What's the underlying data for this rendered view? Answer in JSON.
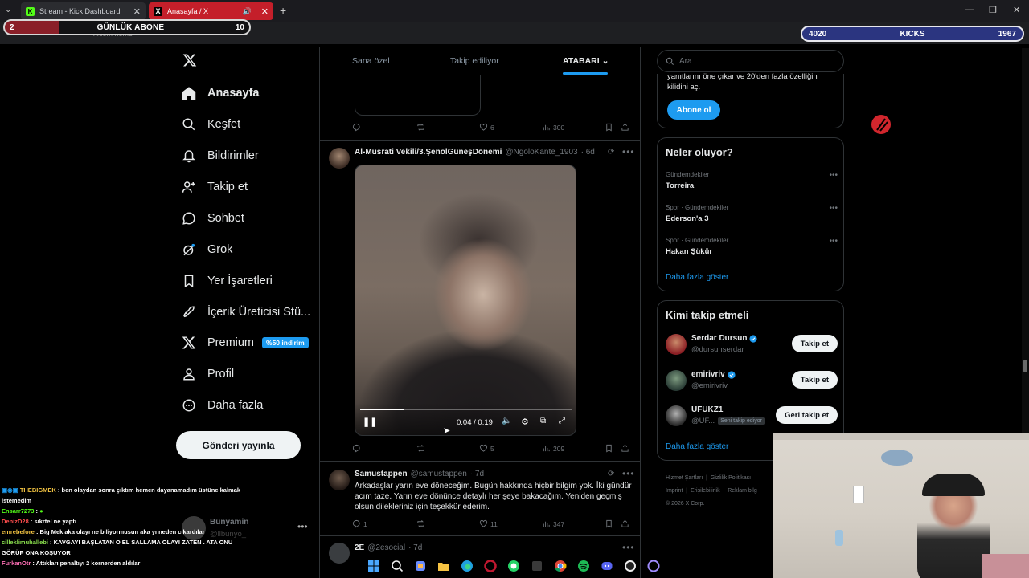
{
  "browser": {
    "tabs": [
      {
        "title": "Stream - Kick Dashboard"
      },
      {
        "title": "Anasayfa / X"
      }
    ],
    "address": "x.com/home"
  },
  "overlay": {
    "gunluk_left": "2",
    "gunluk_label": "GÜNLÜK ABONE",
    "gunluk_right": "10",
    "kicks_left": "4020",
    "kicks_label": "KICKS",
    "kicks_right": "1967"
  },
  "nav": {
    "items": [
      {
        "label": "Anasayfa",
        "icon": "home-icon"
      },
      {
        "label": "Keşfet",
        "icon": "search-icon"
      },
      {
        "label": "Bildirimler",
        "icon": "bell-icon"
      },
      {
        "label": "Takip et",
        "icon": "add-user-icon"
      },
      {
        "label": "Sohbet",
        "icon": "chat-bubble-icon"
      },
      {
        "label": "Grok",
        "icon": "grok-icon"
      },
      {
        "label": "Yer İşaretleri",
        "icon": "bookmark-icon"
      },
      {
        "label": "İçerik Üreticisi Stü...",
        "icon": "rocket-icon"
      },
      {
        "label": "Premium",
        "icon": "x-logo-icon"
      },
      {
        "label": "Profil",
        "icon": "person-icon"
      },
      {
        "label": "Daha fazla",
        "icon": "more-circle-icon"
      }
    ],
    "premium_badge": "%50 indirim",
    "post_button": "Gönderi yayınla",
    "user_name": "Bünyamin",
    "user_handle": "@llbunyo_"
  },
  "timeline": {
    "tabs": [
      "Sana özel",
      "Takip ediliyor",
      "ATABARI"
    ],
    "post0": {
      "likes": "6",
      "views": "300"
    },
    "post1": {
      "name": "Al-Musrati Vekili/3.ŞenolGüneşDönemi",
      "handle": "@NgoloKante_1903",
      "time": "· 6d",
      "video_time": "0:04 / 0:19",
      "video_progress": 0.21,
      "likes": "5",
      "views": "209"
    },
    "post2": {
      "name": "Samustappen",
      "handle": "@samustappen",
      "time": "· 7d",
      "text": "Arkadaşlar yarın eve döneceğim. Bugün hakkında hiçbir bilgim yok. İki gündür acım taze. Yarın eve dönünce detaylı her şeye bakacağım. Yeniden geçmiş olsun dilekleriniz için teşekkür ederim.",
      "replies": "1",
      "likes": "11",
      "views": "347"
    },
    "post3": {
      "name": "2E",
      "handle": "@2esocial",
      "time": "· 7d"
    }
  },
  "sidebar": {
    "search_placeholder": "Ara",
    "premium_text_1": "yanıtlarını öne çıkar ve 20'den fazla özelliğin",
    "premium_text_2": "kilidini aç.",
    "subscribe": "Abone ol",
    "trends_title": "Neler oluyor?",
    "trends": [
      {
        "category": "Gündemdekiler",
        "title": "Torreira"
      },
      {
        "category": "Spor · Gündemdekiler",
        "title": "Ederson'a 3"
      },
      {
        "category": "Spor · Gündemdekiler",
        "title": "Hakan Şükür"
      }
    ],
    "show_more": "Daha fazla göster",
    "wtf_title": "Kimi takip etmeli",
    "who_to_follow": [
      {
        "name": "Serdar Dursun",
        "handle": "@dursunserdar",
        "button": "Takip et"
      },
      {
        "name": "emirivriv",
        "handle": "@emirivriv",
        "button": "Takip et"
      },
      {
        "name": "UFUKZ1",
        "handle": "@UF...",
        "tag": "Seni takip ediyor",
        "button": "Geri takip et"
      }
    ],
    "wtf_show_more": "Daha fazla göster",
    "legal": {
      "l1a": "Hizmet Şartları",
      "l1b": "Gizlilik Politikası",
      "l2a": "Imprint",
      "l2b": "Erişilebilirlik",
      "l2c": "Reklam bilg",
      "l3": "© 2026 X Corp."
    }
  },
  "chat": [
    {
      "user": "THEBIGMEK",
      "color": "#f4c542",
      "msg": "ben olaydan sonra çıktım hemen dayanamadım üstüne kalmak istemedim"
    },
    {
      "user": "Ensarr7273",
      "color": "#53fc18",
      "msg": ""
    },
    {
      "user": "DenizD28",
      "color": "#ff4d4d",
      "msg": "sıkrtel ne yaptı"
    },
    {
      "user": "emrebefore",
      "color": "#f4c542",
      "msg": "Big Mek aka olayı ne biliyormusun aka yı neden cıkardılar"
    },
    {
      "user": "cilleklimuhallebi",
      "color": "#8be04e",
      "msg": "KAVGAYI BAŞLATAN O EL SALLAMA OLAYI ZATEN . ATA ONU GÖRÜP ONA KOŞUYOR"
    },
    {
      "user": "FurkanOtr",
      "color": "#ff6fb5",
      "msg": "Attıkları penaltıyı 2 kornerden aldılar"
    }
  ],
  "colors": {
    "accent": "#1d9bf0",
    "kick_green": "#53fc18"
  }
}
